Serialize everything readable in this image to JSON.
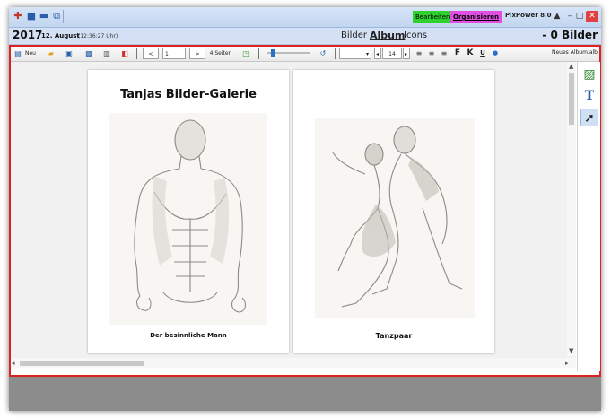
{
  "titlebar": {
    "mode_edit": "Bearbeiten",
    "mode_organize": "Organisieren",
    "app_name": "PixPower 8.0",
    "window_buttons": {
      "up": "▲",
      "minimize": "–",
      "maximize": "□",
      "close": "✕"
    }
  },
  "header": {
    "year": "2017",
    "day_month": "12. August",
    "time": "(12:36:27 Uhr)",
    "view_tabs": [
      {
        "label": "Bilder",
        "active": false
      },
      {
        "label": "Album",
        "active": true
      },
      {
        "label": "Icons",
        "active": false
      }
    ],
    "count": "- 0 Bilder"
  },
  "toolbar": {
    "new_label": "Neu",
    "page_prev": "<",
    "page_number": "1",
    "page_next": ">",
    "page_count": "4 Seiten",
    "font_size": "14",
    "bold": "F",
    "italic": "K",
    "underline": "U",
    "album_name": "Neues Album.alb"
  },
  "album": {
    "title": "Tanjas Bilder-Galerie",
    "pages": [
      {
        "caption": "Der besinnliche Mann"
      },
      {
        "caption": "Tanzpaar"
      }
    ]
  },
  "colors": {
    "accent_red": "#dd2222",
    "mode_edit": "#2fd12f",
    "mode_organize": "#e04fe0"
  }
}
